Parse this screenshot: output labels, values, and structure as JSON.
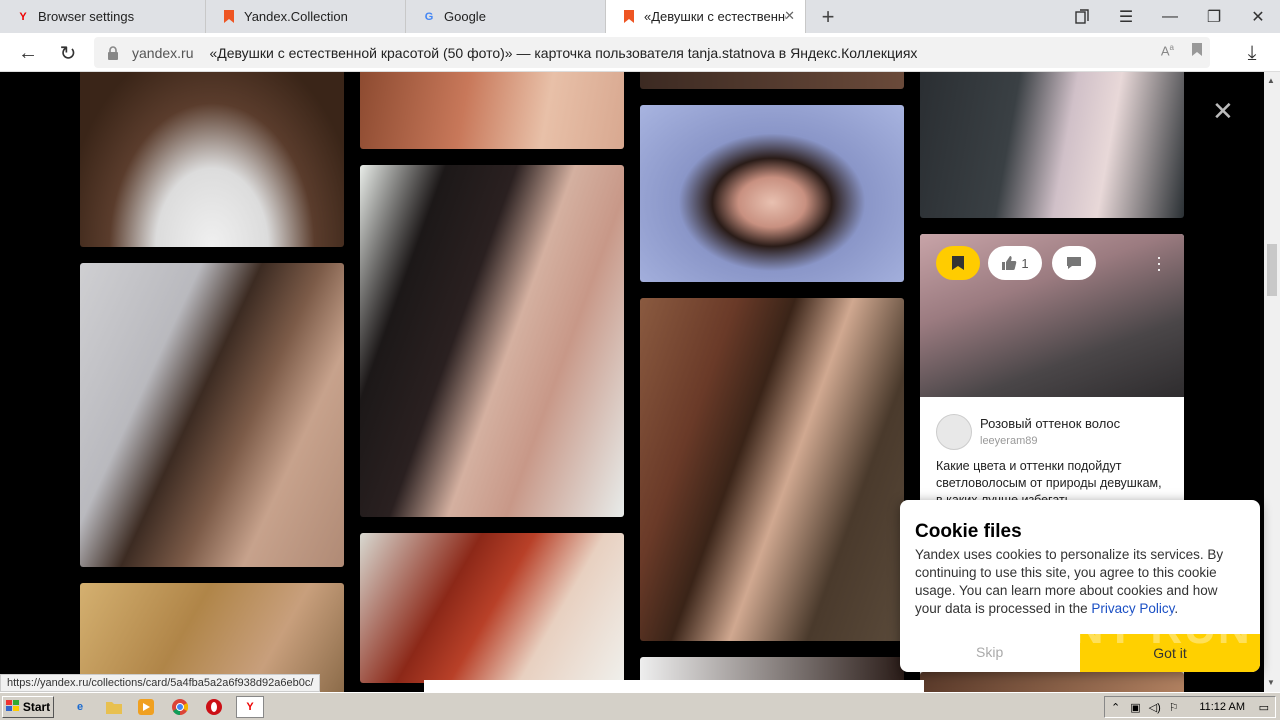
{
  "tabs": [
    {
      "label": "Browser settings",
      "icon": "yandex-browser-icon",
      "color": "#ff0000"
    },
    {
      "label": "Yandex.Collection",
      "icon": "yandex-collection-icon",
      "color": "#e32"
    },
    {
      "label": "Google",
      "icon": "google-icon",
      "color": "#4285f4"
    },
    {
      "label": "«Девушки с естественной",
      "icon": "yandex-collection-icon",
      "color": "#e32"
    }
  ],
  "address": {
    "domain": "yandex.ru",
    "title": "«Девушки с естественной красотой (50 фото)» — карточка пользователя tanja.statnova в Яндекс.Коллекциях"
  },
  "info_card": {
    "like_count": "1",
    "title": "Розовый оттенок волос",
    "user": "leeyeram89",
    "description": "Какие цвета и оттенки подойдут светловолосым от природы девушкам, в каких лучше избегать"
  },
  "cookie": {
    "heading": "Cookie files",
    "text": "Yandex uses cookies to personalize its services. By continuing to use this site, you agree to this cookie usage. You can learn more about cookies and how your data is processed in the",
    "link": "Privacy Policy",
    "after_link": ".",
    "skip_label": "Skip",
    "got_it_label": "Got it"
  },
  "watermark": "ANY RUN",
  "status_url": "https://yandex.ru/collections/card/5a4fba5a2a6f938d92a6eb0c/",
  "taskbar": {
    "start_label": "Start",
    "clock": "11:12 AM"
  }
}
